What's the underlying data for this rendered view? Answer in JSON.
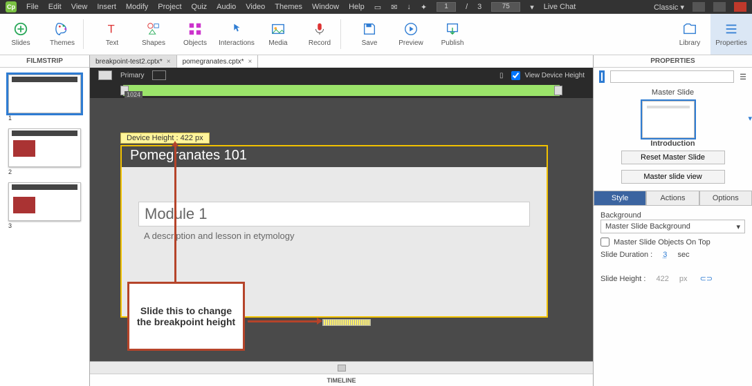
{
  "menu": {
    "items": [
      "File",
      "Edit",
      "View",
      "Insert",
      "Modify",
      "Project",
      "Quiz",
      "Audio",
      "Video",
      "Themes",
      "Window",
      "Help"
    ],
    "page_cur": "1",
    "page_sep": "/",
    "page_total": "3",
    "zoom": "75",
    "live_chat": "Live Chat",
    "workspace": "Classic"
  },
  "ribbon": {
    "slides": "Slides",
    "themes": "Themes",
    "text": "Text",
    "shapes": "Shapes",
    "objects": "Objects",
    "interactions": "Interactions",
    "media": "Media",
    "record": "Record",
    "save": "Save",
    "preview": "Preview",
    "publish": "Publish",
    "library": "Library",
    "properties": "Properties"
  },
  "tabs": {
    "a": "breakpoint-test2.cptx*",
    "b": "pomegranates.cptx*"
  },
  "filmstrip": {
    "title": "FILMSTRIP",
    "n1": "1",
    "n2": "2",
    "n3": "3"
  },
  "devbar": {
    "primary": "Primary",
    "view": "View Device Height"
  },
  "ruler": {
    "value": "1024"
  },
  "heightlabel": "Device Height : 422 px",
  "slide": {
    "title": "Pomegranates 101",
    "module": "Module 1",
    "desc": "A description and lesson in etymology"
  },
  "callout": "Slide this to change the breakpoint height",
  "timeline": "TIMELINE",
  "props": {
    "title": "PROPERTIES",
    "master": "Master Slide",
    "intro": "Introduction",
    "reset": "Reset Master Slide",
    "view": "Master slide view",
    "tabs": {
      "style": "Style",
      "actions": "Actions",
      "options": "Options"
    },
    "bg": "Background",
    "bgval": "Master Slide Background",
    "ontop": "Master Slide Objects On Top",
    "dur_l": "Slide Duration :",
    "dur_v": "3",
    "dur_u": "sec",
    "h_l": "Slide Height :",
    "h_v": "422",
    "h_u": "px"
  }
}
